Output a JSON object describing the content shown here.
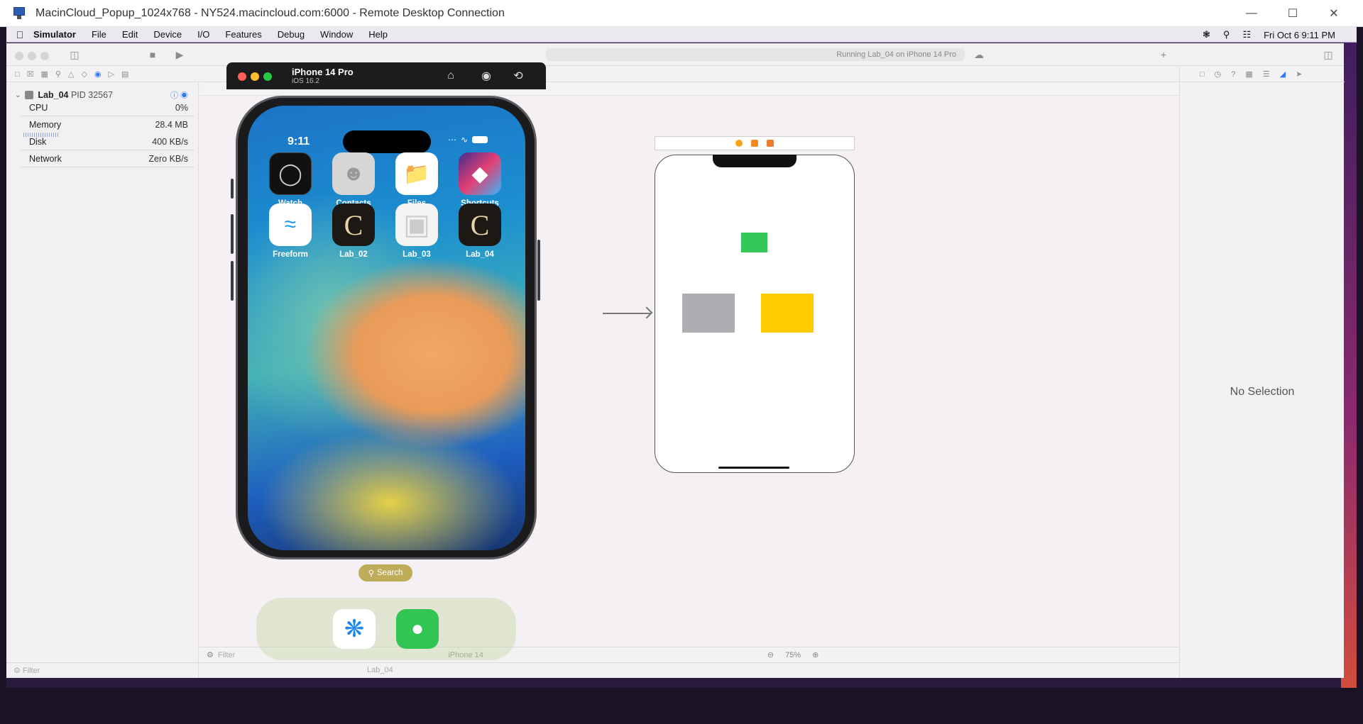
{
  "rdp": {
    "title": "MacinCloud_Popup_1024x768 - NY524.macincloud.com:6000 - Remote Desktop Connection",
    "minimize": "—",
    "maximize": "☐",
    "close": "✕"
  },
  "menubar": {
    "apple": "",
    "app_name": "Simulator",
    "items": [
      "File",
      "Edit",
      "Device",
      "I/O",
      "Features",
      "Debug",
      "Window",
      "Help"
    ],
    "clock": "Fri Oct 6  9:11 PM"
  },
  "xcode": {
    "activity": "Running Lab_04 on iPhone 14 Pro",
    "process": {
      "name": "Lab_04",
      "pid": "PID 32567",
      "rows": [
        {
          "label": "CPU",
          "value": "0%"
        },
        {
          "label": "Memory",
          "value": "28.4 MB"
        },
        {
          "label": "Disk",
          "value": "400 KB/s"
        },
        {
          "label": "Network",
          "value": "Zero KB/s"
        }
      ]
    },
    "filter_placeholder": "Filter",
    "canvas_filter": "Filter",
    "device_label": "iPhone 14",
    "zoom": "75%",
    "debug_target": "Lab_04",
    "inspector_empty": "No Selection"
  },
  "storyboard": {
    "boxes": [
      {
        "name": "green",
        "color": "#34c759"
      },
      {
        "name": "gray",
        "color": "#aeaeb2"
      },
      {
        "name": "yellow",
        "color": "#ffcc00"
      }
    ]
  },
  "simulator": {
    "device": "iPhone 14 Pro",
    "os": "iOS 16.2",
    "time": "9:11",
    "apps": [
      {
        "label": "Watch",
        "icon": "watch-icon"
      },
      {
        "label": "Contacts",
        "icon": "contacts-icon"
      },
      {
        "label": "Files",
        "icon": "files-icon"
      },
      {
        "label": "Shortcuts",
        "icon": "shortcuts-icon"
      },
      {
        "label": "Freeform",
        "icon": "freeform-icon"
      },
      {
        "label": "Lab_02",
        "icon": "lab-app-icon"
      },
      {
        "label": "Lab_03",
        "icon": "blank-app-icon"
      },
      {
        "label": "Lab_04",
        "icon": "lab-app-icon"
      }
    ],
    "search": "Search",
    "dock": [
      "safari-icon",
      "messages-icon"
    ]
  }
}
